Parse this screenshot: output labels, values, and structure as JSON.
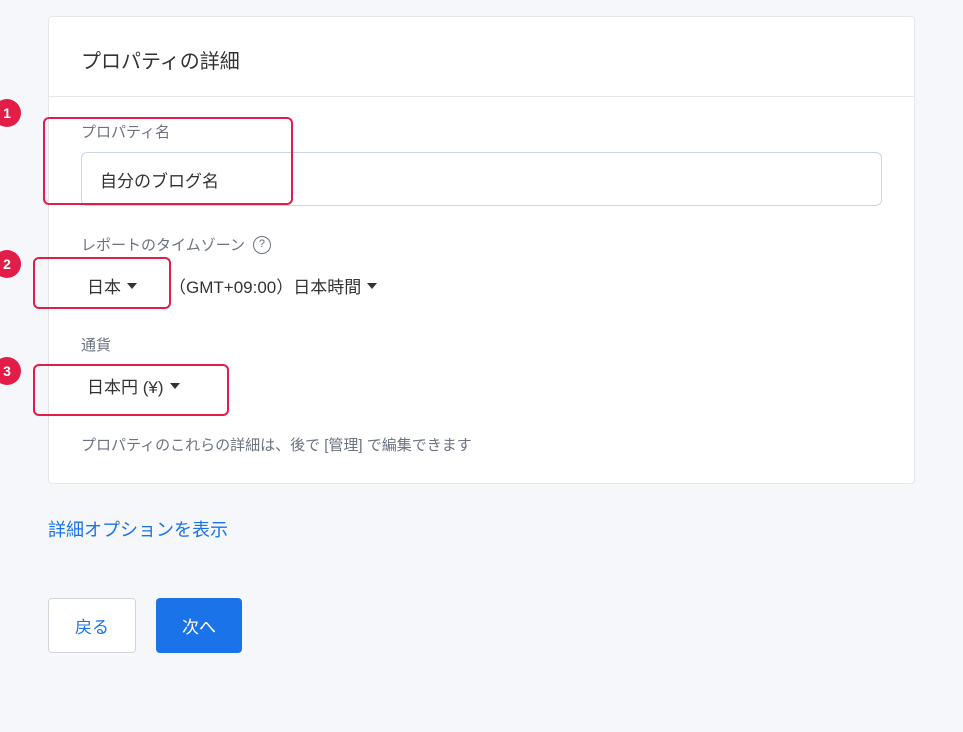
{
  "header": {
    "title": "プロパティの詳細"
  },
  "fields": {
    "property_name": {
      "label": "プロパティ名",
      "value": "自分のブログ名"
    },
    "timezone": {
      "label": "レポートのタイムゾーン",
      "country": "日本",
      "offset": "（GMT+09:00）日本時間"
    },
    "currency": {
      "label": "通貨",
      "value": "日本円 (¥)"
    }
  },
  "note": "プロパティのこれらの詳細は、後で [管理] で編集できます",
  "advanced_link": "詳細オプションを表示",
  "buttons": {
    "back": "戻る",
    "next": "次へ"
  },
  "markers": {
    "one": "1",
    "two": "2",
    "three": "3"
  }
}
